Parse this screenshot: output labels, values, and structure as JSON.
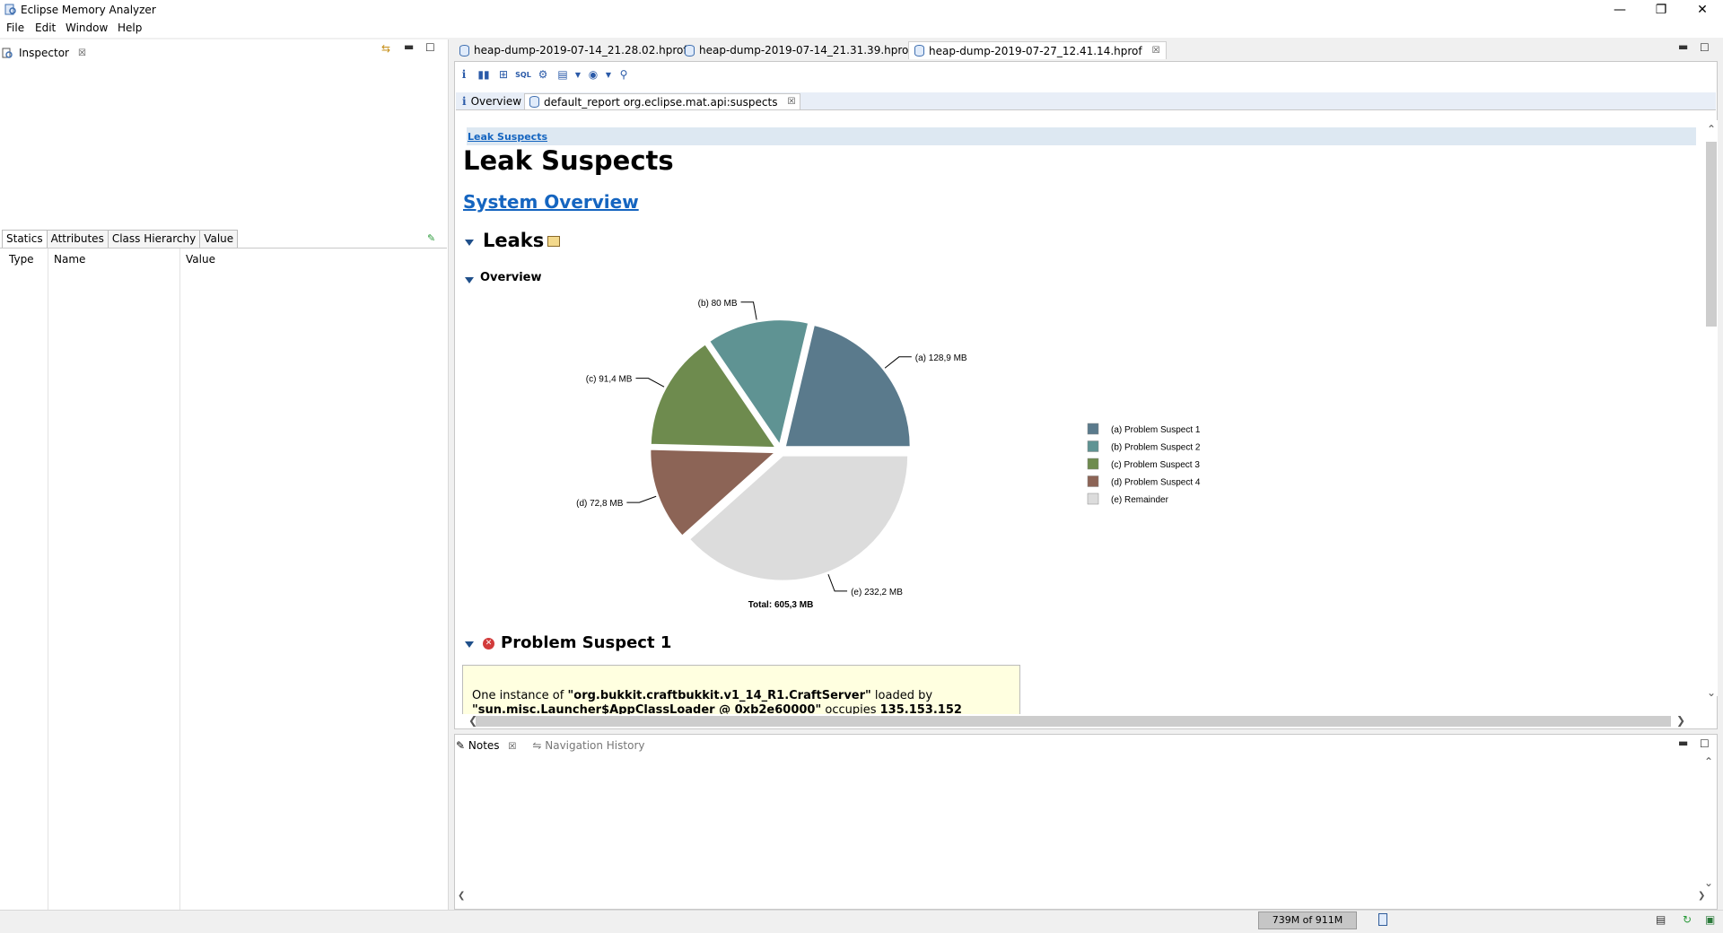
{
  "window": {
    "title": "Eclipse Memory Analyzer",
    "controls": {
      "minimize": "—",
      "restore": "❐",
      "close": "✕"
    }
  },
  "menu": [
    "File",
    "Edit",
    "Window",
    "Help"
  ],
  "inspector": {
    "title": "Inspector",
    "tabs": [
      "Statics",
      "Attributes",
      "Class Hierarchy",
      "Value"
    ],
    "columns": [
      "Type",
      "Name",
      "Value"
    ]
  },
  "editor": {
    "tabs": [
      "heap-dump-2019-07-14_21.28.02.hprof",
      "heap-dump-2019-07-14_21.31.39.hprof",
      "heap-dump-2019-07-27_12.41.14.hprof"
    ],
    "report_tabs": [
      "Overview",
      "default_report  org.eclipse.mat.api:suspects"
    ]
  },
  "report": {
    "breadcrumb": "Leak Suspects",
    "title": "Leak Suspects",
    "system_overview": "System Overview",
    "leaks_heading": "Leaks",
    "overview_heading": "Overview",
    "problem_heading": "Problem Suspect 1",
    "problem_box": {
      "t1": "One instance of ",
      "b1": "\"org.bukkit.craftbukkit.v1_14_R1.CraftServer\"",
      "t2": " loaded by",
      "b2": "\"sun.misc.Launcher$AppClassLoader @ 0xb2e60000\"",
      "t3": " occupies ",
      "b3": "135.153.152"
    }
  },
  "chart_data": {
    "type": "pie",
    "total_label": "Total: 605,3 MB",
    "slices": [
      {
        "key": "(a)",
        "label": "128,9 MB",
        "value": 128.9,
        "legend": "Problem Suspect 1",
        "color": "#5a7a8c"
      },
      {
        "key": "(b)",
        "label": "80 MB",
        "value": 80,
        "legend": "Problem Suspect 2",
        "color": "#5f9393"
      },
      {
        "key": "(c)",
        "label": "91,4 MB",
        "value": 91.4,
        "legend": "Problem Suspect 3",
        "color": "#6e8b4e"
      },
      {
        "key": "(d)",
        "label": "72,8 MB",
        "value": 72.8,
        "legend": "Problem Suspect 4",
        "color": "#8c6456"
      },
      {
        "key": "(e)",
        "label": "232,2 MB",
        "value": 232.2,
        "legend": "Remainder",
        "color": "#dcdcdc"
      }
    ]
  },
  "notes": {
    "tabs": [
      "Notes",
      "Navigation History"
    ]
  },
  "status": {
    "heap": "739M of 911M"
  }
}
